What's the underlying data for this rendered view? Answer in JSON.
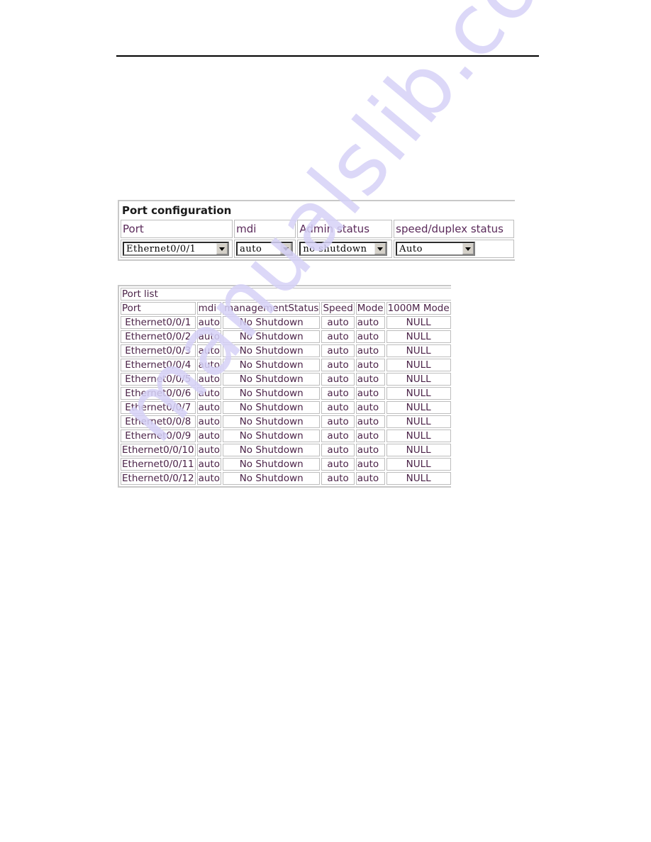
{
  "watermark": "manualslib.com",
  "port_configuration": {
    "title": "Port configuration",
    "headers": [
      "Port",
      "mdi",
      "Admin status",
      "speed/duplex status"
    ],
    "controls": {
      "port": {
        "value": "Ethernet0/0/1"
      },
      "mdi": {
        "value": "auto"
      },
      "admin_status": {
        "value": "no shutdown"
      },
      "speed_duplex": {
        "value": "Auto"
      }
    }
  },
  "port_list": {
    "title": "Port list",
    "headers": [
      "Port",
      "mdi",
      "managementStatus",
      "Speed",
      "Mode",
      "1000M Mode"
    ],
    "rows": [
      {
        "port": "Ethernet0/0/1",
        "mdi": "auto",
        "status": "No Shutdown",
        "speed": "auto",
        "mode": "auto",
        "mode1000": "NULL"
      },
      {
        "port": "Ethernet0/0/2",
        "mdi": "auto",
        "status": "No Shutdown",
        "speed": "auto",
        "mode": "auto",
        "mode1000": "NULL"
      },
      {
        "port": "Ethernet0/0/3",
        "mdi": "auto",
        "status": "No Shutdown",
        "speed": "auto",
        "mode": "auto",
        "mode1000": "NULL"
      },
      {
        "port": "Ethernet0/0/4",
        "mdi": "auto",
        "status": "No Shutdown",
        "speed": "auto",
        "mode": "auto",
        "mode1000": "NULL"
      },
      {
        "port": "Ethernet0/0/5",
        "mdi": "auto",
        "status": "No Shutdown",
        "speed": "auto",
        "mode": "auto",
        "mode1000": "NULL"
      },
      {
        "port": "Ethernet0/0/6",
        "mdi": "auto",
        "status": "No Shutdown",
        "speed": "auto",
        "mode": "auto",
        "mode1000": "NULL"
      },
      {
        "port": "Ethernet0/0/7",
        "mdi": "auto",
        "status": "No Shutdown",
        "speed": "auto",
        "mode": "auto",
        "mode1000": "NULL"
      },
      {
        "port": "Ethernet0/0/8",
        "mdi": "auto",
        "status": "No Shutdown",
        "speed": "auto",
        "mode": "auto",
        "mode1000": "NULL"
      },
      {
        "port": "Ethernet0/0/9",
        "mdi": "auto",
        "status": "No Shutdown",
        "speed": "auto",
        "mode": "auto",
        "mode1000": "NULL"
      },
      {
        "port": "Ethernet0/0/10",
        "mdi": "auto",
        "status": "No Shutdown",
        "speed": "auto",
        "mode": "auto",
        "mode1000": "NULL"
      },
      {
        "port": "Ethernet0/0/11",
        "mdi": "auto",
        "status": "No Shutdown",
        "speed": "auto",
        "mode": "auto",
        "mode1000": "NULL"
      },
      {
        "port": "Ethernet0/0/12",
        "mdi": "auto",
        "status": "No Shutdown",
        "speed": "auto",
        "mode": "auto",
        "mode1000": "NULL"
      }
    ]
  }
}
